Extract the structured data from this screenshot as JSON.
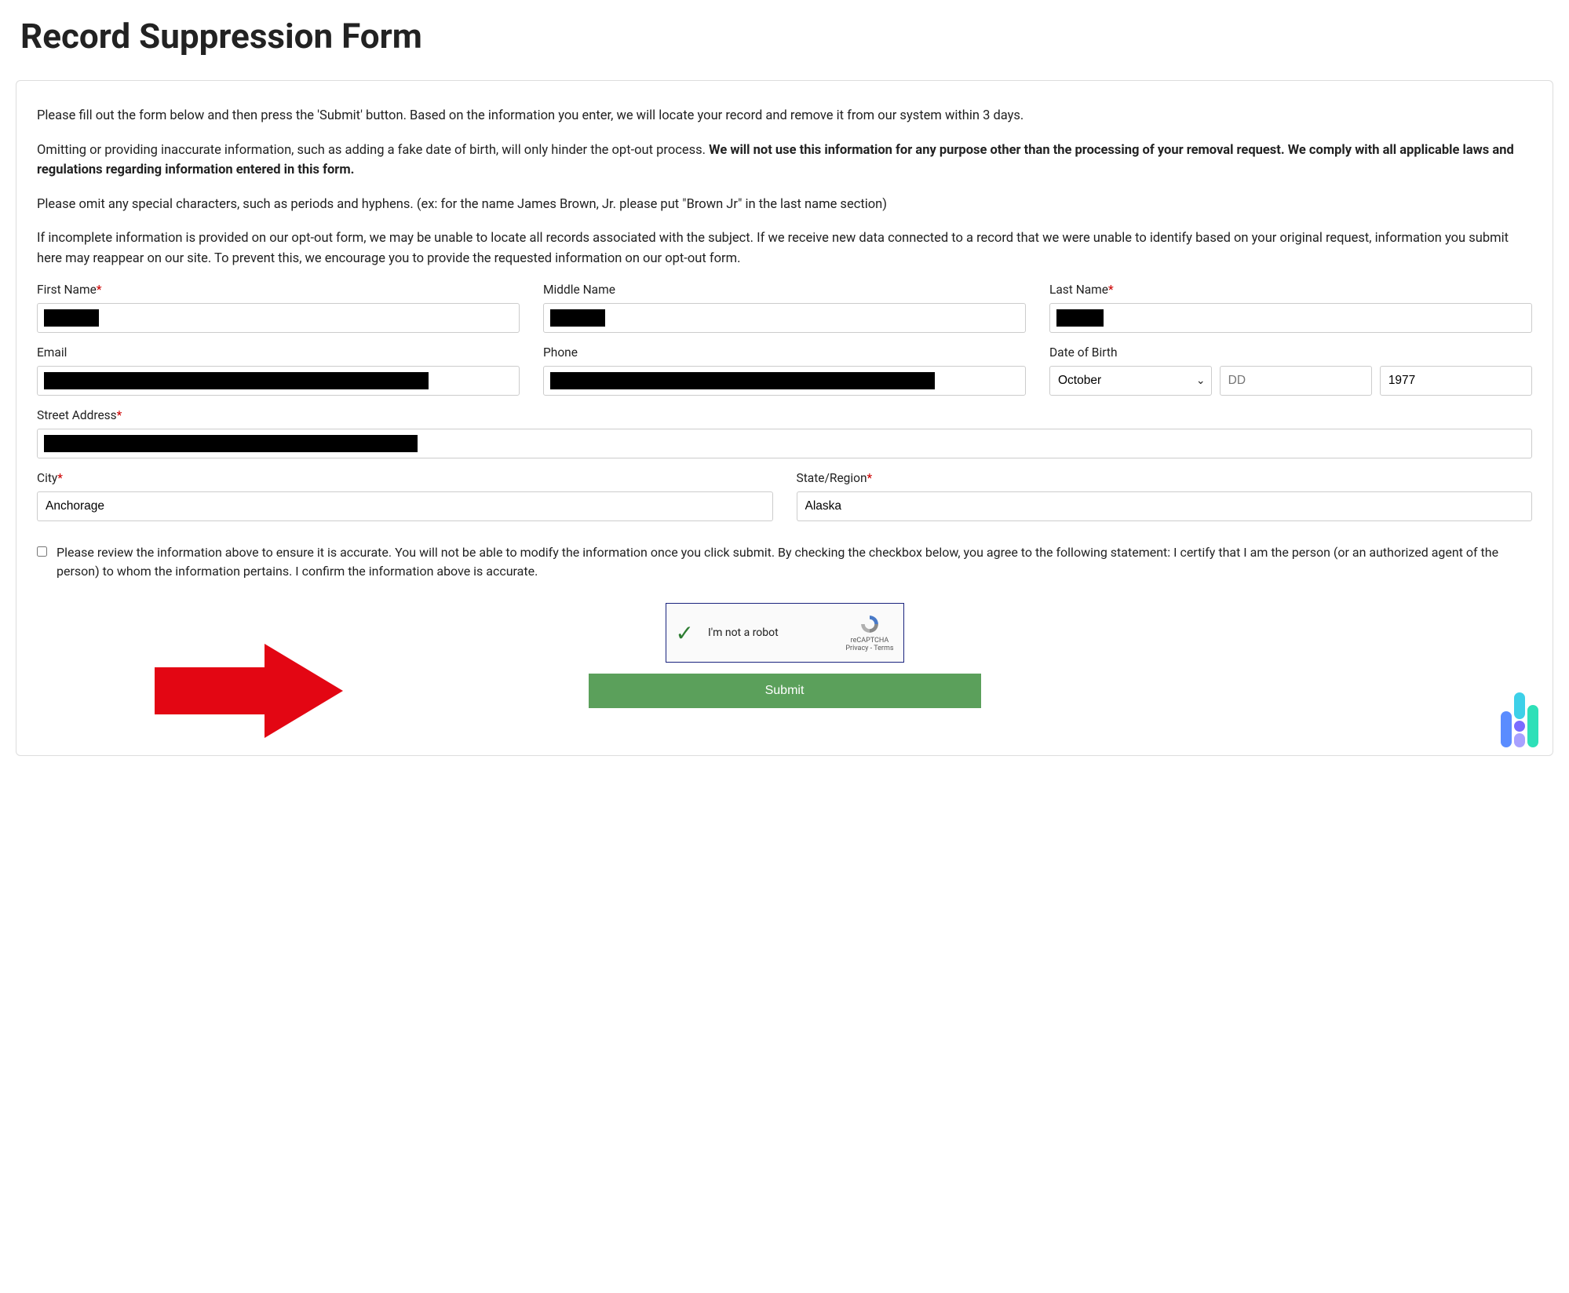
{
  "title": "Record Suppression Form",
  "intro": {
    "p1": "Please fill out the form below and then press the 'Submit' button. Based on the information you enter, we will locate your record and remove it from our system within 3 days.",
    "p2a": "Omitting or providing inaccurate information, such as adding a fake date of birth, will only hinder the opt-out process. ",
    "p2b": "We will not use this information for any purpose other than the processing of your removal request. We comply with all applicable laws and regulations regarding information entered in this form.",
    "p3": "Please omit any special characters, such as periods and hyphens. (ex: for the name James Brown, Jr. please put \"Brown Jr\" in the last name section)",
    "p4": "If incomplete information is provided on our opt-out form, we may be unable to locate all records associated with the subject. If we receive new data connected to a record that we were unable to identify based on your original request, information you submit here may reappear on our site. To prevent this, we encourage you to provide the requested information on our opt-out form."
  },
  "labels": {
    "first_name": "First Name",
    "middle_name": "Middle Name",
    "last_name": "Last Name",
    "email": "Email",
    "phone": "Phone",
    "dob": "Date of Birth",
    "street": "Street Address",
    "city": "City",
    "state": "State/Region"
  },
  "values": {
    "dob_month": "October",
    "dob_day_placeholder": "DD",
    "dob_year": "1977",
    "city": "Anchorage",
    "state": "Alaska"
  },
  "consent_text": "Please review the information above to ensure it is accurate. You will not be able to modify the information once you click submit. By checking the checkbox below, you agree to the following statement: I certify that I am the person (or an authorized agent of the person) to whom the information pertains. I confirm the information above is accurate.",
  "captcha": {
    "text": "I'm not a robot",
    "brand": "reCAPTCHA",
    "terms": "Privacy - Terms"
  },
  "submit_label": "Submit"
}
